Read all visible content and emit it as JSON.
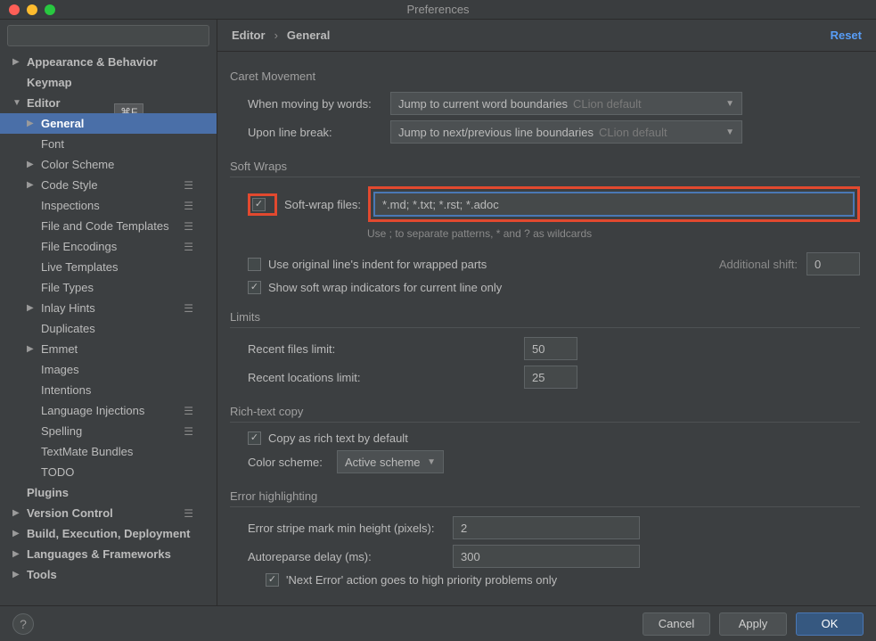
{
  "window": {
    "title": "Preferences"
  },
  "search": {
    "placeholder": ""
  },
  "tooltip": {
    "shortcut": "⌘F"
  },
  "tree": {
    "appearance": "Appearance & Behavior",
    "keymap": "Keymap",
    "editor": "Editor",
    "general": "General",
    "font": "Font",
    "color_scheme": "Color Scheme",
    "code_style": "Code Style",
    "inspections": "Inspections",
    "file_code_templates": "File and Code Templates",
    "file_encodings": "File Encodings",
    "live_templates": "Live Templates",
    "file_types": "File Types",
    "inlay_hints": "Inlay Hints",
    "duplicates": "Duplicates",
    "emmet": "Emmet",
    "images": "Images",
    "intentions": "Intentions",
    "language_injections": "Language Injections",
    "spelling": "Spelling",
    "textmate_bundles": "TextMate Bundles",
    "todo": "TODO",
    "plugins": "Plugins",
    "version_control": "Version Control",
    "build": "Build, Execution, Deployment",
    "languages_frameworks": "Languages & Frameworks",
    "tools": "Tools"
  },
  "breadcrumb": {
    "a": "Editor",
    "b": "General",
    "reset": "Reset"
  },
  "caret": {
    "section": "Caret Movement",
    "when_label": "When moving by words:",
    "when_value": "Jump to current word boundaries",
    "when_hint": "CLion default",
    "upon_label": "Upon line break:",
    "upon_value": "Jump to next/previous line boundaries",
    "upon_hint": "CLion default"
  },
  "soft": {
    "section": "Soft Wraps",
    "wrap_label": "Soft-wrap files:",
    "wrap_value": "*.md; *.txt; *.rst; *.adoc",
    "hint": "Use ; to separate patterns, * and ? as wildcards",
    "use_original": "Use original line's indent for wrapped parts",
    "addl_label": "Additional shift:",
    "addl_value": "0",
    "show_indicators": "Show soft wrap indicators for current line only"
  },
  "limits": {
    "section": "Limits",
    "recent_files_label": "Recent files limit:",
    "recent_files_value": "50",
    "recent_locations_label": "Recent locations limit:",
    "recent_locations_value": "25"
  },
  "rich": {
    "section": "Rich-text copy",
    "copy_default": "Copy as rich text by default",
    "color_label": "Color scheme:",
    "color_value": "Active scheme"
  },
  "error": {
    "section": "Error highlighting",
    "stripe_label": "Error stripe mark min height (pixels):",
    "stripe_value": "2",
    "autoreparse_label": "Autoreparse delay (ms):",
    "autoreparse_value": "300",
    "next_error": "'Next Error' action goes to high priority problems only"
  },
  "footer": {
    "cancel": "Cancel",
    "apply": "Apply",
    "ok": "OK"
  }
}
